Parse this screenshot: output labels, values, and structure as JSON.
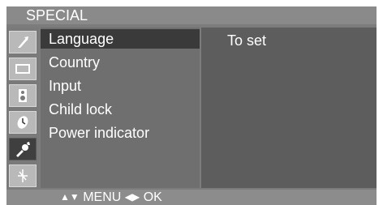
{
  "title": "SPECIAL",
  "icons": [
    {
      "name": "picture-icon",
      "active": false
    },
    {
      "name": "screen-icon",
      "active": false
    },
    {
      "name": "sound-icon",
      "active": false
    },
    {
      "name": "time-icon",
      "active": false
    },
    {
      "name": "special-icon",
      "active": true
    },
    {
      "name": "station-icon",
      "active": false
    }
  ],
  "menu": {
    "items": [
      {
        "label": "Language",
        "selected": true
      },
      {
        "label": "Country",
        "selected": false
      },
      {
        "label": "Input",
        "selected": false
      },
      {
        "label": "Child lock",
        "selected": false
      },
      {
        "label": "Power indicator",
        "selected": false
      }
    ]
  },
  "submenu": {
    "value": "To set"
  },
  "footer": {
    "updown_glyph": "▲▼",
    "menu_label": "MENU",
    "leftright_glyph": "◀▶",
    "ok_label": "OK"
  },
  "colors": {
    "selected_bg": "#3a3a3a",
    "panel_bg": "#5d5d5d"
  }
}
